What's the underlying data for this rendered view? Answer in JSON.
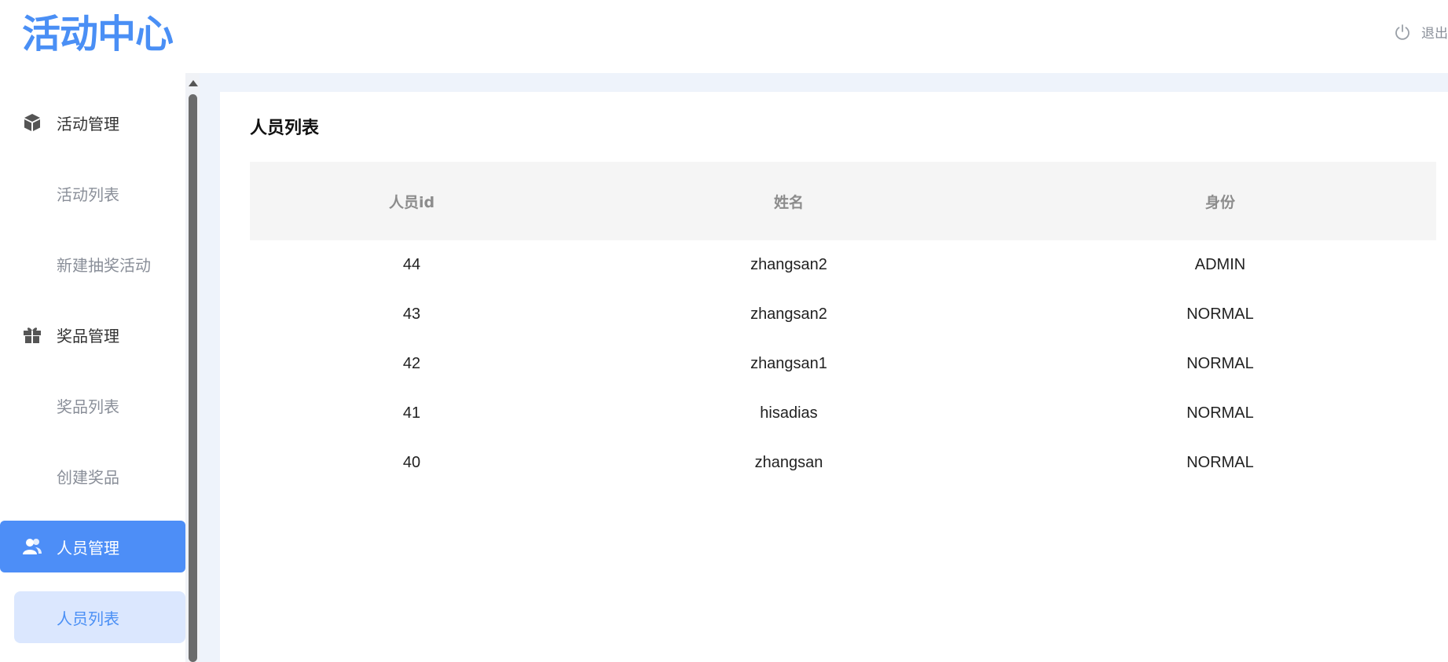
{
  "header": {
    "logo_text": "活动中心",
    "logout_label": "退出",
    "accent_color": "#4a8ff5"
  },
  "sidebar": {
    "groups": [
      {
        "label": "活动管理",
        "icon": "cube-icon",
        "items": [
          {
            "label": "活动列表"
          },
          {
            "label": "新建抽奖活动"
          }
        ]
      },
      {
        "label": "奖品管理",
        "icon": "gift-icon",
        "items": [
          {
            "label": "奖品列表"
          },
          {
            "label": "创建奖品"
          }
        ]
      },
      {
        "label": "人员管理",
        "icon": "users-icon",
        "active": true,
        "items": [
          {
            "label": "人员列表",
            "active": true
          }
        ]
      }
    ]
  },
  "main": {
    "title": "人员列表",
    "table": {
      "columns": [
        "人员id",
        "姓名",
        "身份"
      ],
      "rows": [
        [
          "44",
          "zhangsan2",
          "ADMIN"
        ],
        [
          "43",
          "zhangsan2",
          "NORMAL"
        ],
        [
          "42",
          "zhangsan1",
          "NORMAL"
        ],
        [
          "41",
          "hisadias",
          "NORMAL"
        ],
        [
          "40",
          "zhangsan",
          "NORMAL"
        ]
      ]
    }
  }
}
